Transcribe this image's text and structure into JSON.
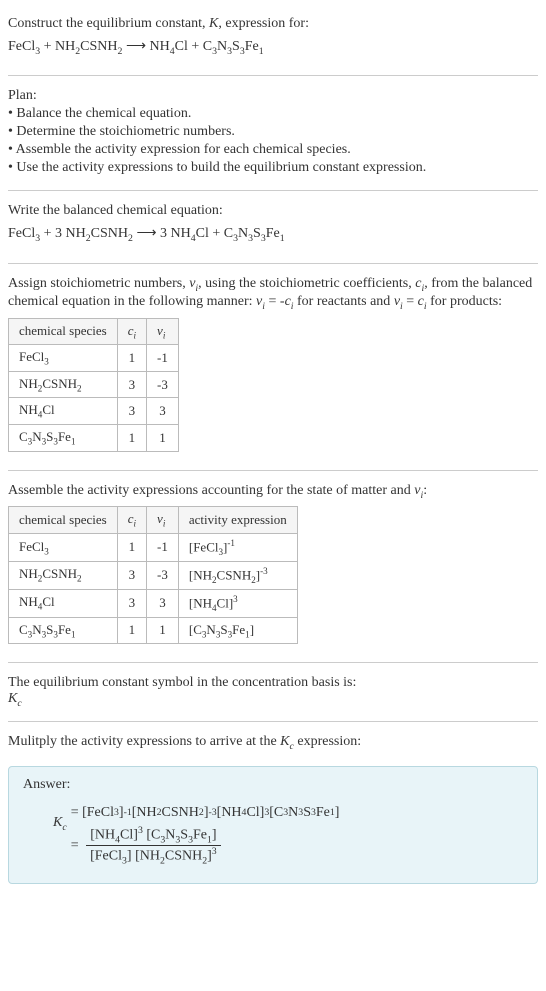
{
  "header": {
    "line1": "Construct the equilibrium constant, K, expression for:",
    "equation": "FeCl₃ + NH₂CSNH₂ ⟶ NH₄Cl + C₃N₃S₃Fe₁"
  },
  "plan": {
    "title": "Plan:",
    "items": [
      "• Balance the chemical equation.",
      "• Determine the stoichiometric numbers.",
      "• Assemble the activity expression for each chemical species.",
      "• Use the activity expressions to build the equilibrium constant expression."
    ]
  },
  "balanced": {
    "title": "Write the balanced chemical equation:",
    "equation": "FeCl₃ + 3 NH₂CSNH₂ ⟶ 3 NH₄Cl + C₃N₃S₃Fe₁"
  },
  "stoich": {
    "text": "Assign stoichiometric numbers, νᵢ, using the stoichiometric coefficients, cᵢ, from the balanced chemical equation in the following manner: νᵢ = -cᵢ for reactants and νᵢ = cᵢ for products:",
    "headers": {
      "species": "chemical species",
      "ci": "cᵢ",
      "vi": "νᵢ"
    },
    "rows": [
      {
        "species": "FeCl₃",
        "ci": "1",
        "vi": "-1"
      },
      {
        "species": "NH₂CSNH₂",
        "ci": "3",
        "vi": "-3"
      },
      {
        "species": "NH₄Cl",
        "ci": "3",
        "vi": "3"
      },
      {
        "species": "C₃N₃S₃Fe₁",
        "ci": "1",
        "vi": "1"
      }
    ]
  },
  "activity": {
    "text": "Assemble the activity expressions accounting for the state of matter and νᵢ:",
    "headers": {
      "species": "chemical species",
      "ci": "cᵢ",
      "vi": "νᵢ",
      "expr": "activity expression"
    },
    "rows": [
      {
        "species": "FeCl₃",
        "ci": "1",
        "vi": "-1",
        "expr": "[FeCl₃]⁻¹"
      },
      {
        "species": "NH₂CSNH₂",
        "ci": "3",
        "vi": "-3",
        "expr": "[NH₂CSNH₂]⁻³"
      },
      {
        "species": "NH₄Cl",
        "ci": "3",
        "vi": "3",
        "expr": "[NH₄Cl]³"
      },
      {
        "species": "C₃N₃S₃Fe₁",
        "ci": "1",
        "vi": "1",
        "expr": "[C₃N₃S₃Fe₁]"
      }
    ]
  },
  "eqsymbol": {
    "text": "The equilibrium constant symbol in the concentration basis is:",
    "symbol": "K_c"
  },
  "multiply": {
    "text": "Mulitply the activity expressions to arrive at the K_c expression:"
  },
  "answer": {
    "label": "Answer:",
    "kc": "K_c",
    "line1": "= [FeCl₃]⁻¹ [NH₂CSNH₂]⁻³ [NH₄Cl]³ [C₃N₃S₃Fe₁]",
    "eq2": "=",
    "numerator": "[NH₄Cl]³ [C₃N₃S₃Fe₁]",
    "denominator": "[FeCl₃] [NH₂CSNH₂]³"
  }
}
